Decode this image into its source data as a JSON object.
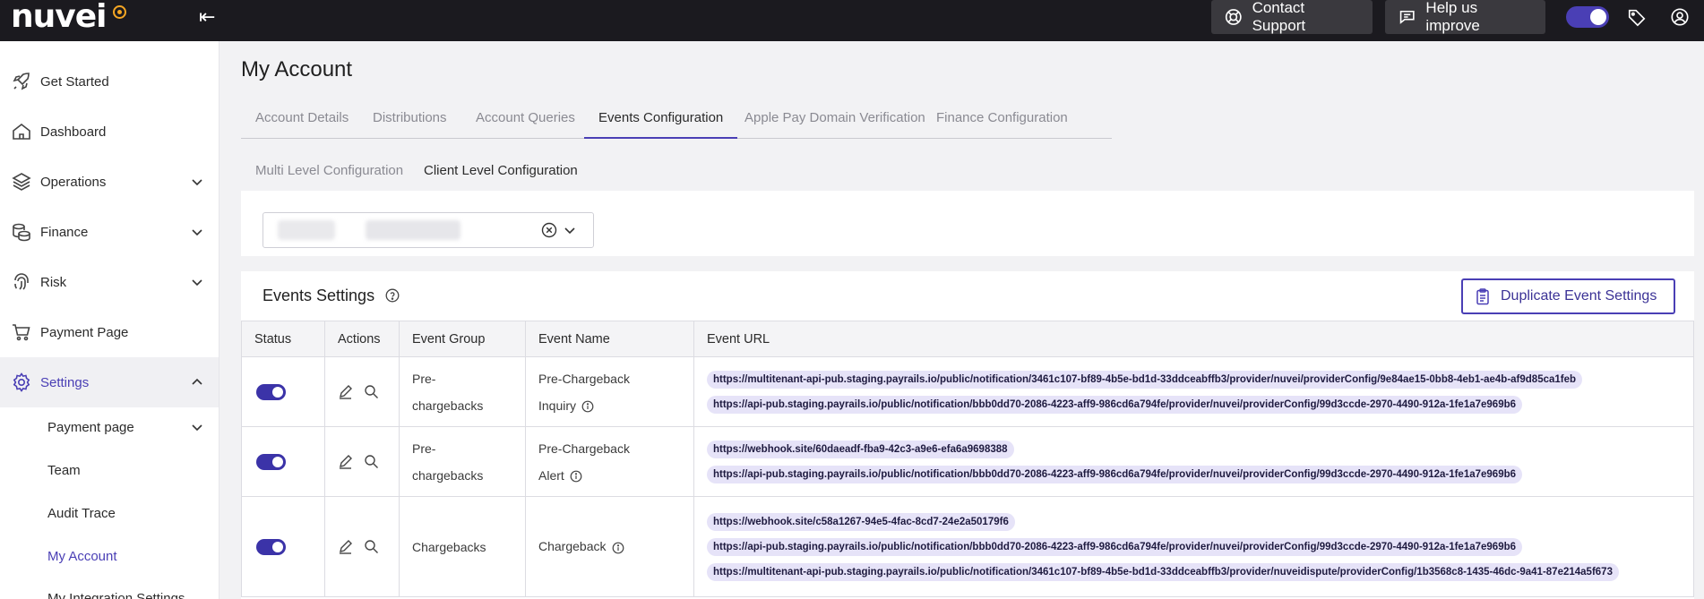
{
  "topbar": {
    "logo_text": "nuvei",
    "contact_support": "Contact Support",
    "help_improve": "Help us improve"
  },
  "sidebar": {
    "items": [
      {
        "label": "Get Started",
        "icon": "rocket-icon"
      },
      {
        "label": "Dashboard",
        "icon": "home-icon"
      },
      {
        "label": "Operations",
        "icon": "layers-icon"
      },
      {
        "label": "Finance",
        "icon": "coins-icon"
      },
      {
        "label": "Risk",
        "icon": "fingerprint-icon"
      },
      {
        "label": "Payment Page",
        "icon": "cart-icon"
      },
      {
        "label": "Settings",
        "icon": "gear-icon"
      }
    ],
    "sub_items": [
      {
        "label": "Payment page"
      },
      {
        "label": "Team"
      },
      {
        "label": "Audit Trace"
      },
      {
        "label": "My Account"
      },
      {
        "label": "My Integration Settings"
      }
    ]
  },
  "main": {
    "title": "My Account",
    "tabs": [
      {
        "label": "Account Details"
      },
      {
        "label": "Distributions"
      },
      {
        "label": "Account Queries"
      },
      {
        "label": "Events Configuration"
      },
      {
        "label": "Apple Pay Domain Verification"
      },
      {
        "label": "Finance Configuration"
      }
    ],
    "subtabs": [
      {
        "label": "Multi Level Configuration"
      },
      {
        "label": "Client Level Configuration"
      }
    ],
    "events": {
      "title": "Events Settings",
      "duplicate_label": "Duplicate Event Settings",
      "columns": [
        "Status",
        "Actions",
        "Event Group",
        "Event Name",
        "Event URL"
      ],
      "rows": [
        {
          "group_line1": "Pre-",
          "group_line2": "chargebacks",
          "name_line1": "Pre-Chargeback",
          "name_line2": "Inquiry",
          "urls": [
            "https://multitenant-api-pub.staging.payrails.io/public/notification/3461c107-bf89-4b5e-bd1d-33ddceabffb3/provider/nuvei/providerConfig/9e84ae15-0bb8-4eb1-ae4b-af9d85ca1feb",
            "https://api-pub.staging.payrails.io/public/notification/bbb0dd70-2086-4223-aff9-986cd6a794fe/provider/nuvei/providerConfig/99d3ccde-2970-4490-912a-1fe1a7e969b6"
          ]
        },
        {
          "group_line1": "Pre-",
          "group_line2": "chargebacks",
          "name_line1": "Pre-Chargeback",
          "name_line2": "Alert",
          "urls": [
            "https://webhook.site/60daeadf-fba9-42c3-a9e6-efa6a9698388",
            "https://api-pub.staging.payrails.io/public/notification/bbb0dd70-2086-4223-aff9-986cd6a794fe/provider/nuvei/providerConfig/99d3ccde-2970-4490-912a-1fe1a7e969b6"
          ]
        },
        {
          "group_line1": "Chargebacks",
          "name_line1": "Chargeback",
          "urls": [
            "https://webhook.site/c58a1267-94e5-4fac-8cd7-24e2a50179f6",
            "https://api-pub.staging.payrails.io/public/notification/bbb0dd70-2086-4223-aff9-986cd6a794fe/provider/nuvei/providerConfig/99d3ccde-2970-4490-912a-1fe1a7e969b6",
            "https://multitenant-api-pub.staging.payrails.io/public/notification/3461c107-bf89-4b5e-bd1d-33ddceabffb3/provider/nuveidispute/providerConfig/1b3568c8-1435-46dc-9a41-87e214a5f673"
          ]
        }
      ]
    }
  },
  "colors": {
    "accent": "#4a3fb5",
    "topbar": "#1b1a1f",
    "url_chip": "#e6e3f8"
  }
}
